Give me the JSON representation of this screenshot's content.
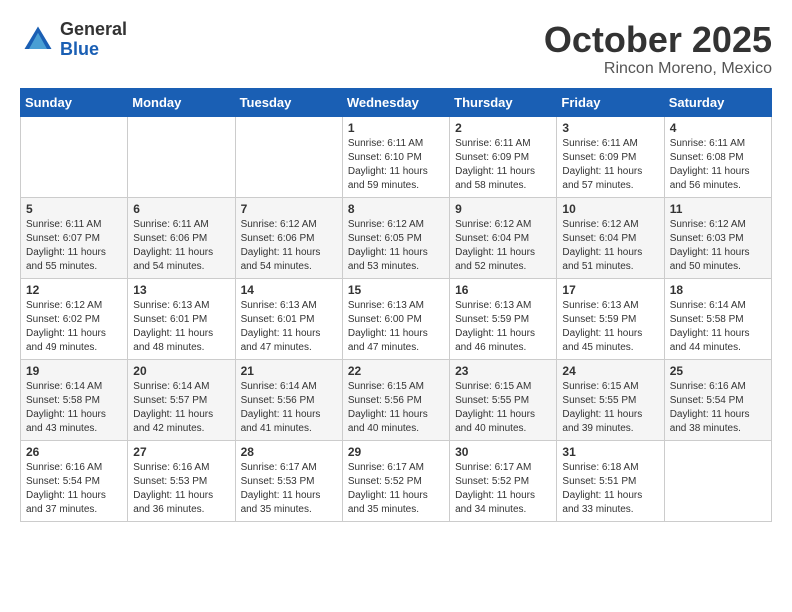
{
  "header": {
    "logo_general": "General",
    "logo_blue": "Blue",
    "month_title": "October 2025",
    "location": "Rincon Moreno, Mexico"
  },
  "weekdays": [
    "Sunday",
    "Monday",
    "Tuesday",
    "Wednesday",
    "Thursday",
    "Friday",
    "Saturday"
  ],
  "weeks": [
    [
      {
        "day": "",
        "info": ""
      },
      {
        "day": "",
        "info": ""
      },
      {
        "day": "",
        "info": ""
      },
      {
        "day": "1",
        "info": "Sunrise: 6:11 AM\nSunset: 6:10 PM\nDaylight: 11 hours\nand 59 minutes."
      },
      {
        "day": "2",
        "info": "Sunrise: 6:11 AM\nSunset: 6:09 PM\nDaylight: 11 hours\nand 58 minutes."
      },
      {
        "day": "3",
        "info": "Sunrise: 6:11 AM\nSunset: 6:09 PM\nDaylight: 11 hours\nand 57 minutes."
      },
      {
        "day": "4",
        "info": "Sunrise: 6:11 AM\nSunset: 6:08 PM\nDaylight: 11 hours\nand 56 minutes."
      }
    ],
    [
      {
        "day": "5",
        "info": "Sunrise: 6:11 AM\nSunset: 6:07 PM\nDaylight: 11 hours\nand 55 minutes."
      },
      {
        "day": "6",
        "info": "Sunrise: 6:11 AM\nSunset: 6:06 PM\nDaylight: 11 hours\nand 54 minutes."
      },
      {
        "day": "7",
        "info": "Sunrise: 6:12 AM\nSunset: 6:06 PM\nDaylight: 11 hours\nand 54 minutes."
      },
      {
        "day": "8",
        "info": "Sunrise: 6:12 AM\nSunset: 6:05 PM\nDaylight: 11 hours\nand 53 minutes."
      },
      {
        "day": "9",
        "info": "Sunrise: 6:12 AM\nSunset: 6:04 PM\nDaylight: 11 hours\nand 52 minutes."
      },
      {
        "day": "10",
        "info": "Sunrise: 6:12 AM\nSunset: 6:04 PM\nDaylight: 11 hours\nand 51 minutes."
      },
      {
        "day": "11",
        "info": "Sunrise: 6:12 AM\nSunset: 6:03 PM\nDaylight: 11 hours\nand 50 minutes."
      }
    ],
    [
      {
        "day": "12",
        "info": "Sunrise: 6:12 AM\nSunset: 6:02 PM\nDaylight: 11 hours\nand 49 minutes."
      },
      {
        "day": "13",
        "info": "Sunrise: 6:13 AM\nSunset: 6:01 PM\nDaylight: 11 hours\nand 48 minutes."
      },
      {
        "day": "14",
        "info": "Sunrise: 6:13 AM\nSunset: 6:01 PM\nDaylight: 11 hours\nand 47 minutes."
      },
      {
        "day": "15",
        "info": "Sunrise: 6:13 AM\nSunset: 6:00 PM\nDaylight: 11 hours\nand 47 minutes."
      },
      {
        "day": "16",
        "info": "Sunrise: 6:13 AM\nSunset: 5:59 PM\nDaylight: 11 hours\nand 46 minutes."
      },
      {
        "day": "17",
        "info": "Sunrise: 6:13 AM\nSunset: 5:59 PM\nDaylight: 11 hours\nand 45 minutes."
      },
      {
        "day": "18",
        "info": "Sunrise: 6:14 AM\nSunset: 5:58 PM\nDaylight: 11 hours\nand 44 minutes."
      }
    ],
    [
      {
        "day": "19",
        "info": "Sunrise: 6:14 AM\nSunset: 5:58 PM\nDaylight: 11 hours\nand 43 minutes."
      },
      {
        "day": "20",
        "info": "Sunrise: 6:14 AM\nSunset: 5:57 PM\nDaylight: 11 hours\nand 42 minutes."
      },
      {
        "day": "21",
        "info": "Sunrise: 6:14 AM\nSunset: 5:56 PM\nDaylight: 11 hours\nand 41 minutes."
      },
      {
        "day": "22",
        "info": "Sunrise: 6:15 AM\nSunset: 5:56 PM\nDaylight: 11 hours\nand 40 minutes."
      },
      {
        "day": "23",
        "info": "Sunrise: 6:15 AM\nSunset: 5:55 PM\nDaylight: 11 hours\nand 40 minutes."
      },
      {
        "day": "24",
        "info": "Sunrise: 6:15 AM\nSunset: 5:55 PM\nDaylight: 11 hours\nand 39 minutes."
      },
      {
        "day": "25",
        "info": "Sunrise: 6:16 AM\nSunset: 5:54 PM\nDaylight: 11 hours\nand 38 minutes."
      }
    ],
    [
      {
        "day": "26",
        "info": "Sunrise: 6:16 AM\nSunset: 5:54 PM\nDaylight: 11 hours\nand 37 minutes."
      },
      {
        "day": "27",
        "info": "Sunrise: 6:16 AM\nSunset: 5:53 PM\nDaylight: 11 hours\nand 36 minutes."
      },
      {
        "day": "28",
        "info": "Sunrise: 6:17 AM\nSunset: 5:53 PM\nDaylight: 11 hours\nand 35 minutes."
      },
      {
        "day": "29",
        "info": "Sunrise: 6:17 AM\nSunset: 5:52 PM\nDaylight: 11 hours\nand 35 minutes."
      },
      {
        "day": "30",
        "info": "Sunrise: 6:17 AM\nSunset: 5:52 PM\nDaylight: 11 hours\nand 34 minutes."
      },
      {
        "day": "31",
        "info": "Sunrise: 6:18 AM\nSunset: 5:51 PM\nDaylight: 11 hours\nand 33 minutes."
      },
      {
        "day": "",
        "info": ""
      }
    ]
  ]
}
